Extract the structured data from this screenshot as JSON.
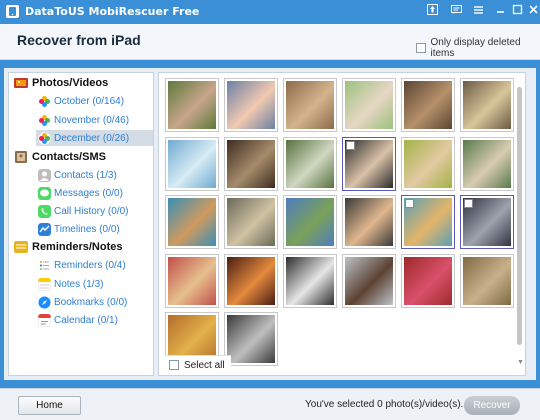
{
  "window": {
    "title": "DataToUS MobiRescuer Free",
    "buttons": [
      "upgrade-icon",
      "feedback-icon",
      "menu-icon",
      "minimize-icon",
      "maximize-icon",
      "close-icon"
    ]
  },
  "header": {
    "title": "Recover from iPad",
    "only_deleted_label": "Only display deleted items",
    "only_deleted_checked": false
  },
  "sidebar": {
    "categories": [
      {
        "label": "Photos/Videos",
        "icon": "photos-videos-icon",
        "items": [
          {
            "label": "October (0/164)",
            "icon": "photos-app-icon",
            "selected": false
          },
          {
            "label": "November (0/46)",
            "icon": "photos-app-icon",
            "selected": false
          },
          {
            "label": "December (0/26)",
            "icon": "photos-app-icon",
            "selected": true
          }
        ]
      },
      {
        "label": "Contacts/SMS",
        "icon": "contacts-sms-icon",
        "items": [
          {
            "label": "Contacts (1/3)",
            "icon": "contacts-app-icon",
            "selected": false
          },
          {
            "label": "Messages (0/0)",
            "icon": "messages-app-icon",
            "selected": false
          },
          {
            "label": "Call History (0/0)",
            "icon": "phone-app-icon",
            "selected": false
          },
          {
            "label": "Timelines (0/0)",
            "icon": "timelines-app-icon",
            "selected": false
          }
        ]
      },
      {
        "label": "Reminders/Notes",
        "icon": "reminders-notes-icon",
        "items": [
          {
            "label": "Reminders (0/4)",
            "icon": "reminders-app-icon",
            "selected": false
          },
          {
            "label": "Notes (1/3)",
            "icon": "notes-app-icon",
            "selected": false
          },
          {
            "label": "Bookmarks (0/0)",
            "icon": "safari-app-icon",
            "selected": false
          },
          {
            "label": "Calendar (0/1)",
            "icon": "calendar-app-icon",
            "selected": false
          }
        ]
      }
    ]
  },
  "grid": {
    "select_all_label": "Select all",
    "select_all_checked": false,
    "photos": [
      {
        "desc": "couple",
        "colors": [
          "#5f7a3c",
          "#c7a58a"
        ]
      },
      {
        "desc": "baby-face",
        "colors": [
          "#6b7fa6",
          "#f1c9b0"
        ]
      },
      {
        "desc": "group-party",
        "colors": [
          "#8c6a4a",
          "#d4b48e"
        ]
      },
      {
        "desc": "baby-crawling",
        "colors": [
          "#9bc27d",
          "#e7d6c4"
        ]
      },
      {
        "desc": "interior",
        "colors": [
          "#5a4633",
          "#b6916b"
        ]
      },
      {
        "desc": "sunset-landscape",
        "colors": [
          "#6b5b45",
          "#d8c59a"
        ]
      },
      {
        "desc": "beach",
        "colors": [
          "#6fa9cf",
          "#d8ecf5"
        ]
      },
      {
        "desc": "meerkat",
        "colors": [
          "#3e2c20",
          "#a68c6c"
        ]
      },
      {
        "desc": "wedding",
        "colors": [
          "#587240",
          "#cfd7c0"
        ]
      },
      {
        "desc": "smiling-man",
        "colors": [
          "#2b2b2b",
          "#d9c1a8"
        ],
        "selected": true
      },
      {
        "desc": "smiling-woman",
        "colors": [
          "#a3b348",
          "#e2c9a2"
        ]
      },
      {
        "desc": "couple-kiss",
        "colors": [
          "#587a4a",
          "#d8ccb4"
        ]
      },
      {
        "desc": "dog-jumping",
        "colors": [
          "#3a8fb7",
          "#cf9a5f"
        ]
      },
      {
        "desc": "hands",
        "colors": [
          "#6c6a5a",
          "#cfc2a2"
        ]
      },
      {
        "desc": "sound-of-music",
        "colors": [
          "#4f7dbf",
          "#7aa159"
        ]
      },
      {
        "desc": "laughing-woman",
        "colors": [
          "#3a3a3a",
          "#e0b68e"
        ]
      },
      {
        "desc": "holding-hands",
        "colors": [
          "#5b9fb6",
          "#e3b56a"
        ],
        "selected": true
      },
      {
        "desc": "women-group",
        "colors": [
          "#2f3240",
          "#9fa3ad"
        ],
        "selected": true
      },
      {
        "desc": "couple-laughing",
        "colors": [
          "#c0504a",
          "#e7c08e"
        ]
      },
      {
        "desc": "candles",
        "colors": [
          "#4a1d12",
          "#e48a3d"
        ]
      },
      {
        "desc": "this-is-it",
        "colors": [
          "#2e2e2e",
          "#e6e6e6"
        ]
      },
      {
        "desc": "girl-portrait",
        "colors": [
          "#bcc2c7",
          "#5c4233"
        ]
      },
      {
        "desc": "flower-field",
        "colors": [
          "#9e2a2a",
          "#d9506a"
        ]
      },
      {
        "desc": "street",
        "colors": [
          "#7e6a44",
          "#c8b08a"
        ]
      },
      {
        "desc": "autumn-path",
        "colors": [
          "#b46c2c",
          "#e2b24a"
        ]
      },
      {
        "desc": "bw-couple",
        "colors": [
          "#3a3a3a",
          "#bfbfbf"
        ]
      }
    ]
  },
  "footer": {
    "home_label": "Home",
    "status_text": "You've selected 0 photo(s)/video(s).",
    "recover_label": "Recover"
  }
}
